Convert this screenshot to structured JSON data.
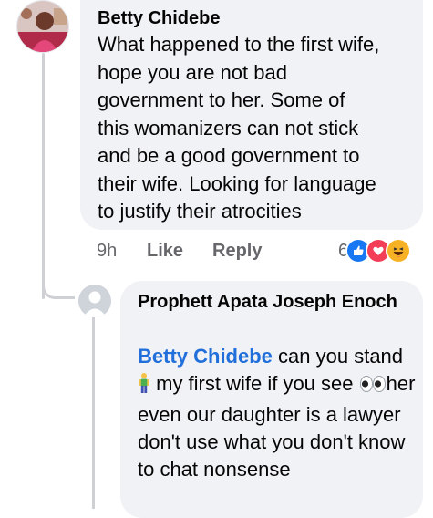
{
  "comment": {
    "author": "Betty Chidebe",
    "text": "What happened to the first wife,\nhope you are not bad\ngovernment to her. Some of\nthis womanizers can not stick\nand be a good government to\ntheir wife. Looking for language\nto justify their atrocities",
    "time": "9h",
    "like_label": "Like",
    "reply_label": "Reply",
    "reaction_count": "6",
    "reactions": [
      "like-reaction-icon",
      "love-reaction-icon",
      "haha-reaction-icon"
    ]
  },
  "reply": {
    "author": "Prophett Apata Joseph Enoch",
    "mention": "Betty Chidebe",
    "text_a": " can you stand ",
    "emoji_a": "person-standing-icon",
    "text_b": " my first wife if you see ",
    "emoji_b": "eyes-icon",
    "text_c": "her even our daughter is a lawyer don't use what you don't know to chat nonsense"
  },
  "colors": {
    "bubble": "#f0f2f5",
    "mention": "#216fdb",
    "meta": "#65676b",
    "like": "#1877f2",
    "love": "#f33e58",
    "haha": "#f7b125"
  }
}
